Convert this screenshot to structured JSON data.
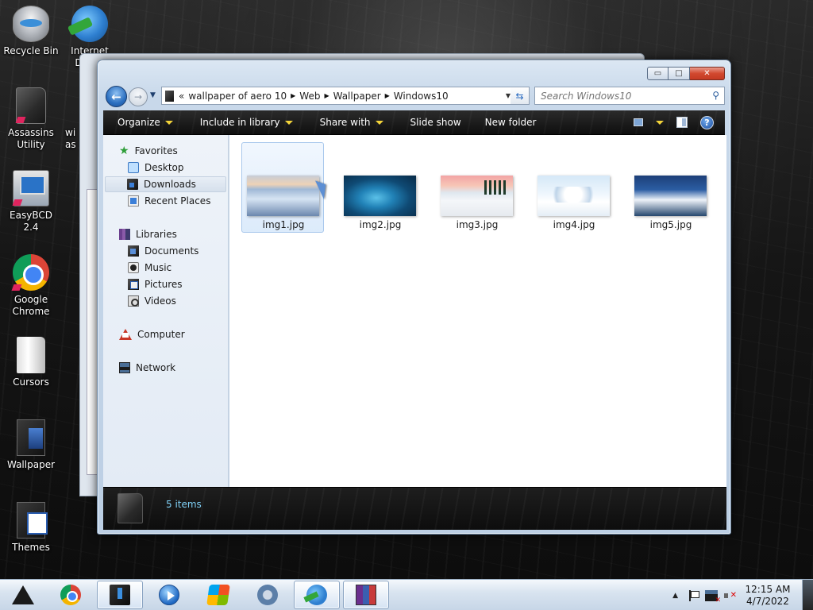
{
  "desktop": {
    "icons": [
      {
        "label": "Recycle Bin",
        "icon": "recycle-bin-icon"
      },
      {
        "label": "Internet\nDownl",
        "icon": "idm-icon"
      },
      {
        "label": "Assassins\nUtility",
        "icon": "folder-icon"
      },
      {
        "label": "EasyBCD 2.4",
        "icon": "easybcd-icon"
      },
      {
        "label": "Google\nChrome",
        "icon": "chrome-icon"
      },
      {
        "label": "Cursors",
        "icon": "folder-icon"
      },
      {
        "label": "Wallpaper",
        "icon": "folder-icon"
      },
      {
        "label": "Themes",
        "icon": "folder-icon"
      }
    ],
    "partial_labels": {
      "wi": "wi",
      "as": "as"
    }
  },
  "explorer": {
    "caption_buttons": {
      "minimize": "▭",
      "maximize": "□",
      "close": "✕"
    },
    "address": {
      "overflow": "«",
      "crumbs": [
        "wallpaper of aero 10",
        "Web",
        "Wallpaper",
        "Windows10"
      ]
    },
    "search": {
      "placeholder": "Search Windows10"
    },
    "toolbar": {
      "organize": "Organize",
      "include_in_library": "Include in library",
      "share_with": "Share with",
      "slide_show": "Slide show",
      "new_folder": "New folder",
      "help": "?"
    },
    "navpane": {
      "favorites": "Favorites",
      "desktop": "Desktop",
      "downloads": "Downloads",
      "recent_places": "Recent Places",
      "libraries": "Libraries",
      "documents": "Documents",
      "music": "Music",
      "pictures": "Pictures",
      "videos": "Videos",
      "computer": "Computer",
      "network": "Network"
    },
    "files": [
      {
        "name": "img1.jpg",
        "selected": true
      },
      {
        "name": "img2.jpg",
        "selected": false
      },
      {
        "name": "img3.jpg",
        "selected": false
      },
      {
        "name": "img4.jpg",
        "selected": false
      },
      {
        "name": "img5.jpg",
        "selected": false
      }
    ],
    "details": {
      "count": "5 items"
    }
  },
  "taskbar": {
    "clock": {
      "time": "12:15 AM",
      "date": "4/7/2022"
    },
    "tray_expand": "▲"
  }
}
